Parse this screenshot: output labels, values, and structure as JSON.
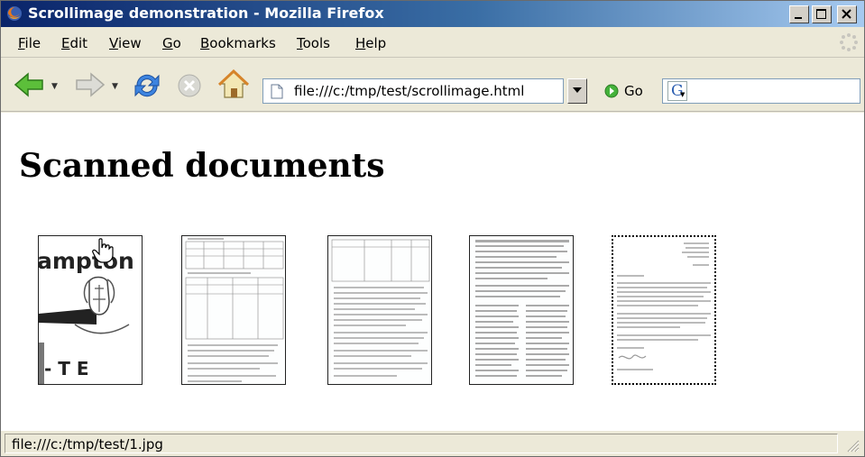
{
  "window": {
    "title": "Scrollimage demonstration - Mozilla Firefox"
  },
  "menu": {
    "items": [
      {
        "first": "F",
        "rest": "ile"
      },
      {
        "first": "E",
        "rest": "dit"
      },
      {
        "first": "V",
        "rest": "iew"
      },
      {
        "first": "G",
        "rest": "o"
      },
      {
        "first": "B",
        "rest": "ookmarks"
      },
      {
        "first": "T",
        "rest": "ools"
      },
      {
        "first": "H",
        "rest": "elp"
      }
    ]
  },
  "toolbar": {
    "url": "file:///c:/tmp/test/scrollimage.html",
    "go_label": "Go",
    "search_engine": "G"
  },
  "page": {
    "heading": "Scanned documents",
    "thumbnails": [
      {
        "name": "scan 1",
        "selected": false
      },
      {
        "name": "scan 2",
        "selected": false
      },
      {
        "name": "scan 3",
        "selected": false
      },
      {
        "name": "scan 4",
        "selected": false
      },
      {
        "name": "scan 5",
        "selected": true
      }
    ],
    "thumb1_text": {
      "top": "ampton",
      "bottom": "- T E"
    }
  },
  "status": {
    "text": "file:///c:/tmp/test/1.jpg"
  },
  "colors": {
    "titlebar_start": "#0a246a",
    "titlebar_end": "#a6caf0",
    "chrome_bg": "#ece9d8",
    "back_arrow": "#3fae2a",
    "reload_blue": "#2a6fd6"
  },
  "icons": [
    "firefox-icon",
    "back-icon",
    "forward-icon",
    "reload-icon",
    "stop-icon",
    "home-icon",
    "page-icon",
    "go-icon",
    "search-engine-icon",
    "throbber-icon",
    "hand-cursor-icon"
  ]
}
